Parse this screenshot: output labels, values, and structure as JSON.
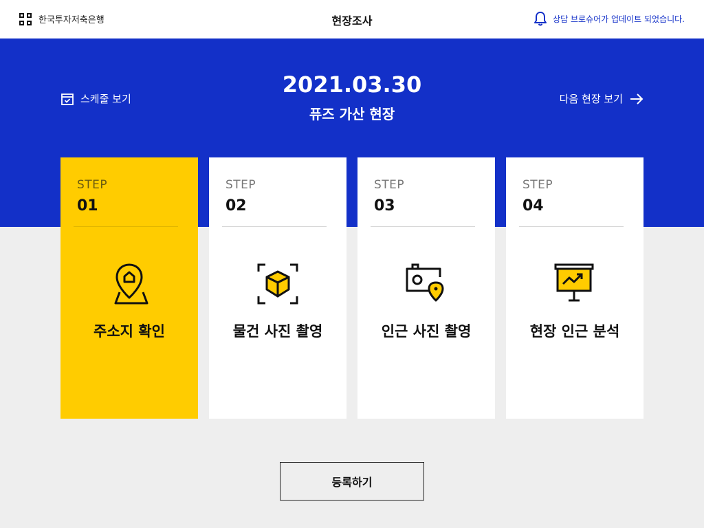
{
  "header": {
    "brand": "한국투자저축은행",
    "title": "현장조사",
    "notice": "상담 브로슈어가 업데이트 되었습니다."
  },
  "hero": {
    "schedule_link": "스케줄 보기",
    "date": "2021.03.30",
    "site_name": "퓨즈 가산 현장",
    "next_link": "다음 현장 보기"
  },
  "steps": [
    {
      "label": "STEP",
      "number": "01",
      "title": "주소지 확인",
      "icon": "map-pin-home-icon",
      "active": true
    },
    {
      "label": "STEP",
      "number": "02",
      "title": "물건 사진 촬영",
      "icon": "box-scan-icon",
      "active": false
    },
    {
      "label": "STEP",
      "number": "03",
      "title": "인근 사진 촬영",
      "icon": "camera-location-icon",
      "active": false
    },
    {
      "label": "STEP",
      "number": "04",
      "title": "현장 인근 분석",
      "icon": "presentation-chart-icon",
      "active": false
    }
  ],
  "register_button": "등록하기",
  "colors": {
    "primary": "#1330c8",
    "accent": "#ffcc00",
    "background": "#eeeeee"
  }
}
